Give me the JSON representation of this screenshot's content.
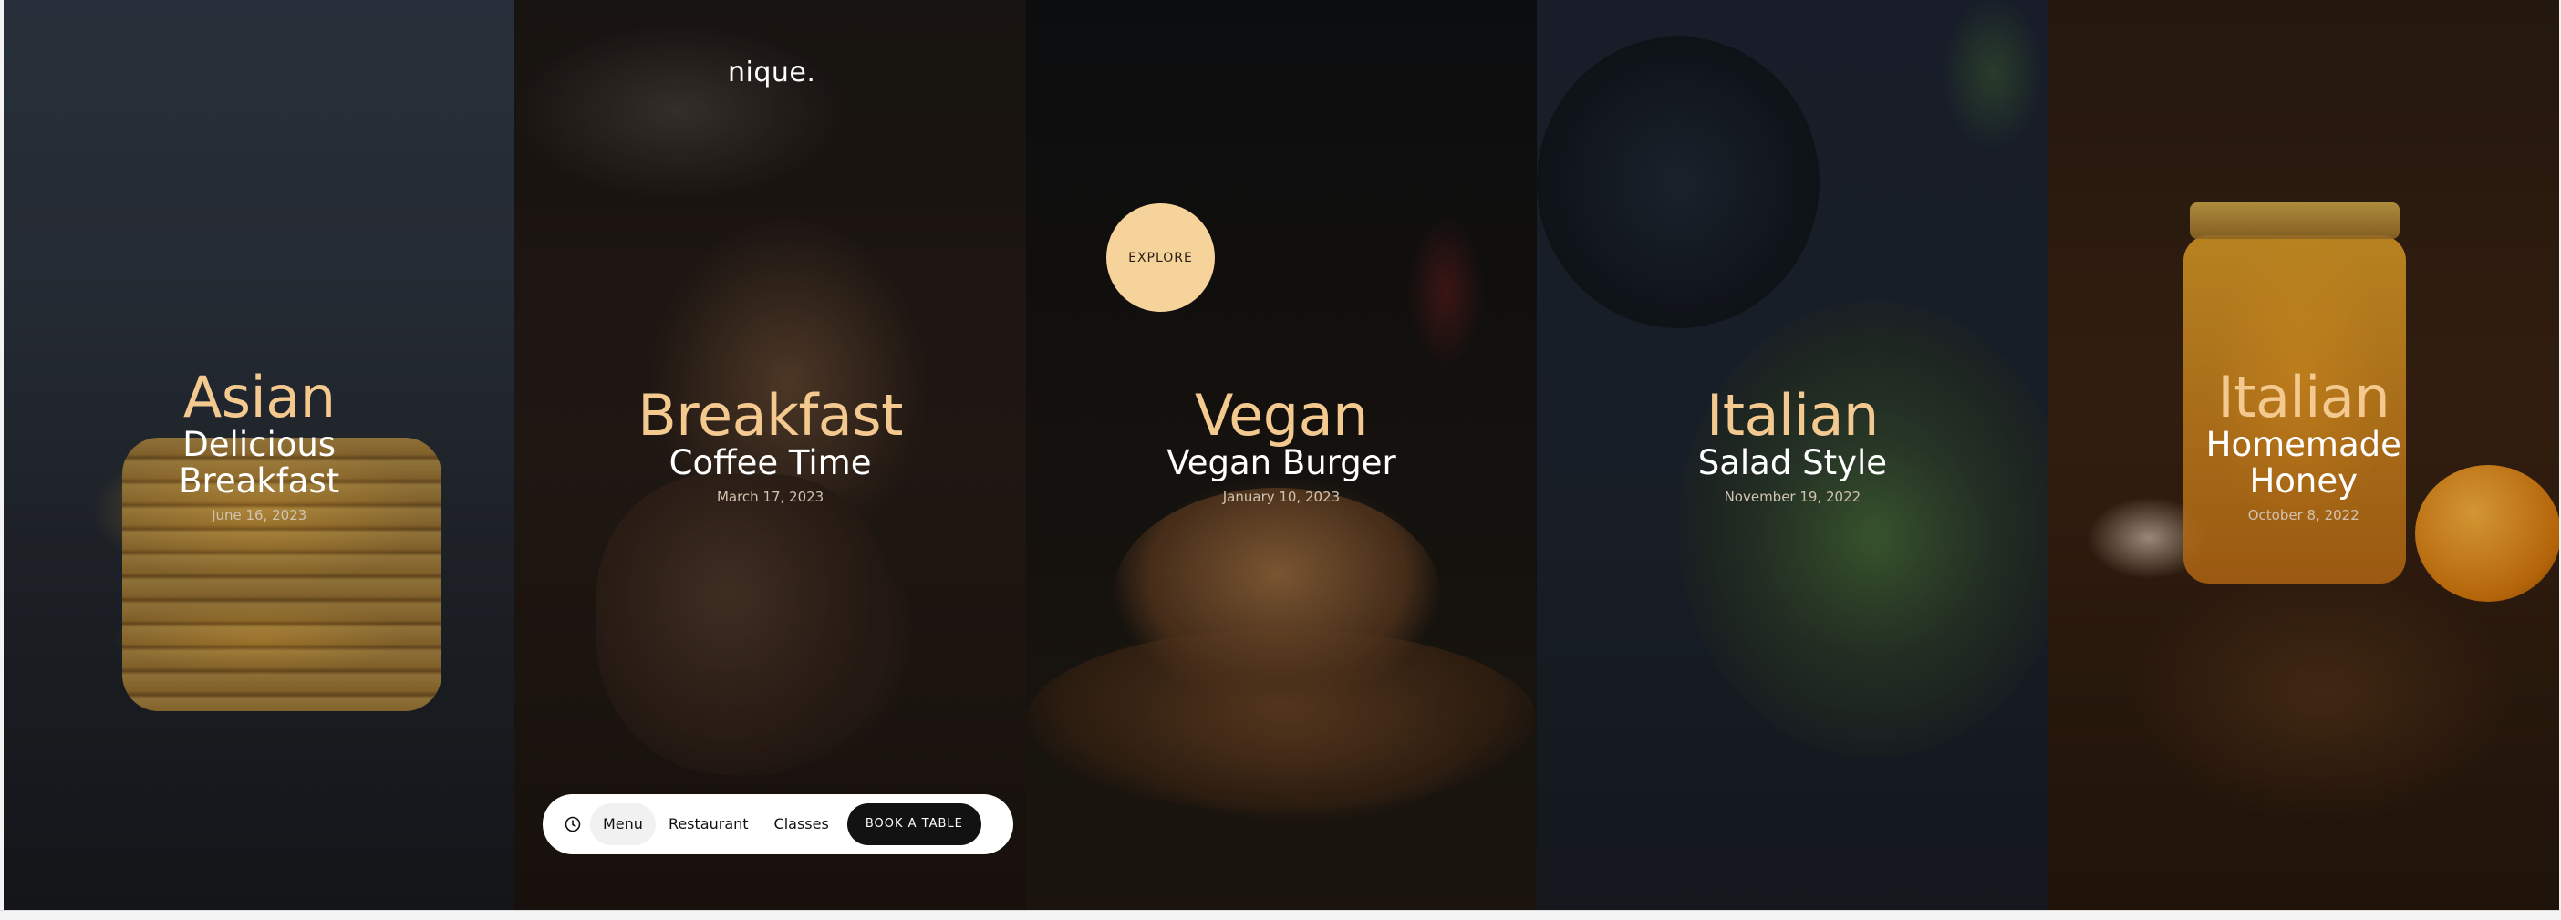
{
  "brand": {
    "logo_text": "nique."
  },
  "explore": {
    "label": "EXPLORE"
  },
  "nav": {
    "menu_label": "Menu",
    "restaurant_label": "Restaurant",
    "classes_label": "Classes",
    "book_label": "BOOK A TABLE",
    "clock_icon": "clock-icon"
  },
  "panels": [
    {
      "category": "Asian",
      "title_line1": "Delicious",
      "title_line2": "Breakfast",
      "date": "June 16, 2023"
    },
    {
      "category": "Breakfast",
      "title_line1": "Coffee Time",
      "title_line2": "",
      "date": "March 17, 2023"
    },
    {
      "category": "Vegan",
      "title_line1": "Vegan Burger",
      "title_line2": "",
      "date": "January 10, 2023"
    },
    {
      "category": "Italian",
      "title_line1": "Salad Style",
      "title_line2": "",
      "date": "November 19, 2022"
    },
    {
      "category": "Italian",
      "title_line1": "Homemade",
      "title_line2": "Honey",
      "date": "October 8, 2022"
    }
  ],
  "colors": {
    "accent": "#f4c98f",
    "explore_bg": "#f6d39b",
    "nav_bg": "#ffffff",
    "book_bg": "#121212"
  }
}
